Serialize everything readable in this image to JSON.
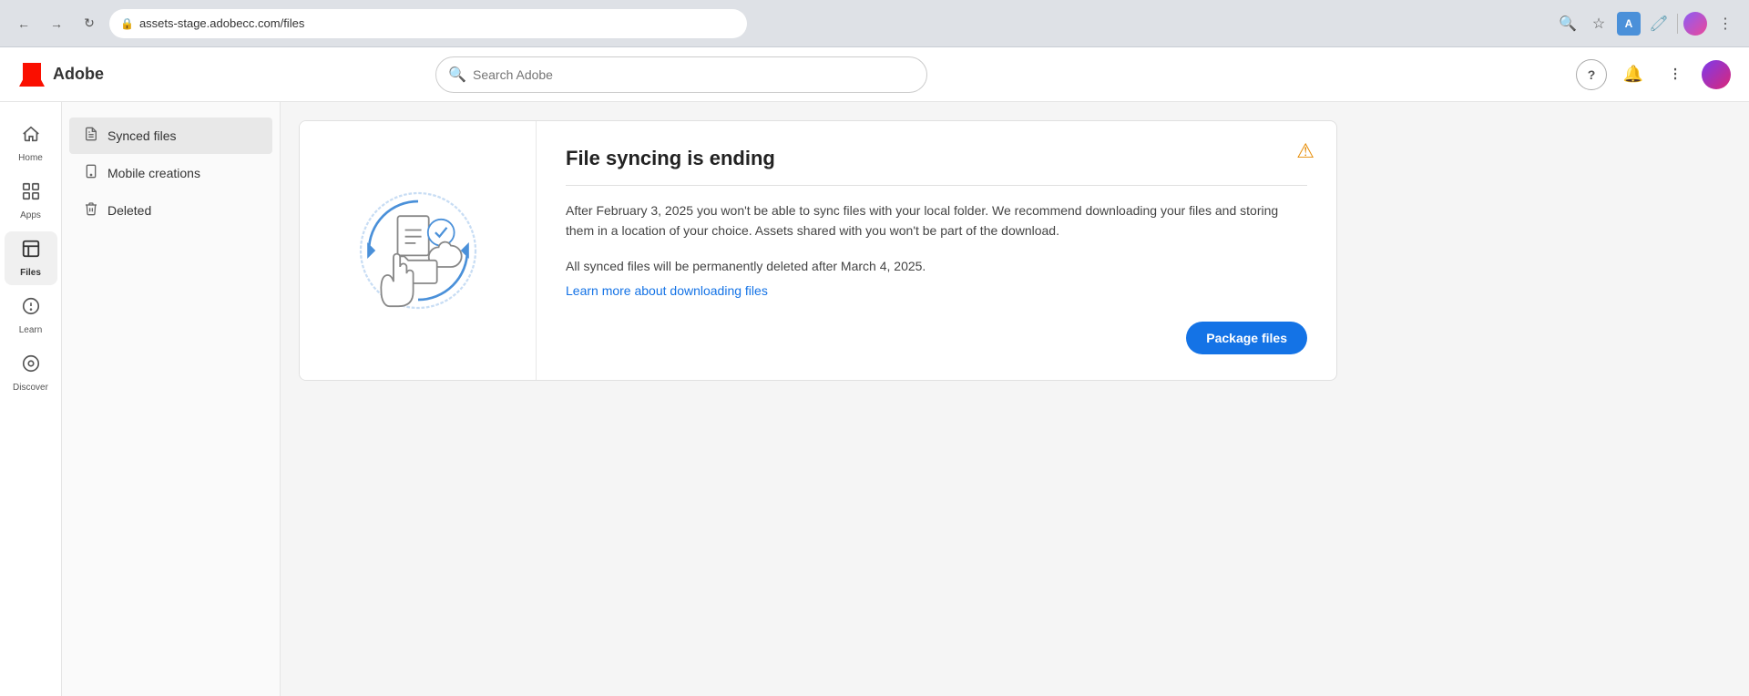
{
  "browser": {
    "back_btn": "←",
    "forward_btn": "→",
    "refresh_btn": "↻",
    "address_icon": "🔒",
    "address_url": "assets-stage.adobecc.com/files",
    "search_icon": "🔍",
    "star_icon": "★",
    "menu_icon": "⋮"
  },
  "header": {
    "logo_text": "Adobe",
    "search_placeholder": "Search Adobe",
    "help_icon": "?",
    "bell_icon": "🔔",
    "grid_icon": "⊞"
  },
  "left_nav": {
    "items": [
      {
        "id": "home",
        "label": "Home",
        "icon": "⌂"
      },
      {
        "id": "apps",
        "label": "Apps",
        "icon": "⊞"
      },
      {
        "id": "files",
        "label": "Files",
        "icon": "📁",
        "active": true
      },
      {
        "id": "learn",
        "label": "Learn",
        "icon": "💡"
      },
      {
        "id": "discover",
        "label": "Discover",
        "icon": "◎"
      }
    ]
  },
  "sidebar": {
    "items": [
      {
        "id": "synced-files",
        "label": "Synced files",
        "icon": "📄",
        "active": true
      },
      {
        "id": "mobile-creations",
        "label": "Mobile creations",
        "icon": "📋"
      },
      {
        "id": "deleted",
        "label": "Deleted",
        "icon": "🗑"
      }
    ]
  },
  "notification": {
    "title": "File syncing is ending",
    "divider": true,
    "body_text": "After February 3, 2025 you won't be able to sync files with your local folder. We recommend downloading your files and storing them in a location of your choice. Assets shared with you won't be part of the download.",
    "secondary_text": "All synced files will be permanently deleted after March 4, 2025.",
    "link_text": "Learn more about downloading files",
    "link_url": "#",
    "warning_icon": "⚠",
    "package_btn_label": "Package files"
  }
}
